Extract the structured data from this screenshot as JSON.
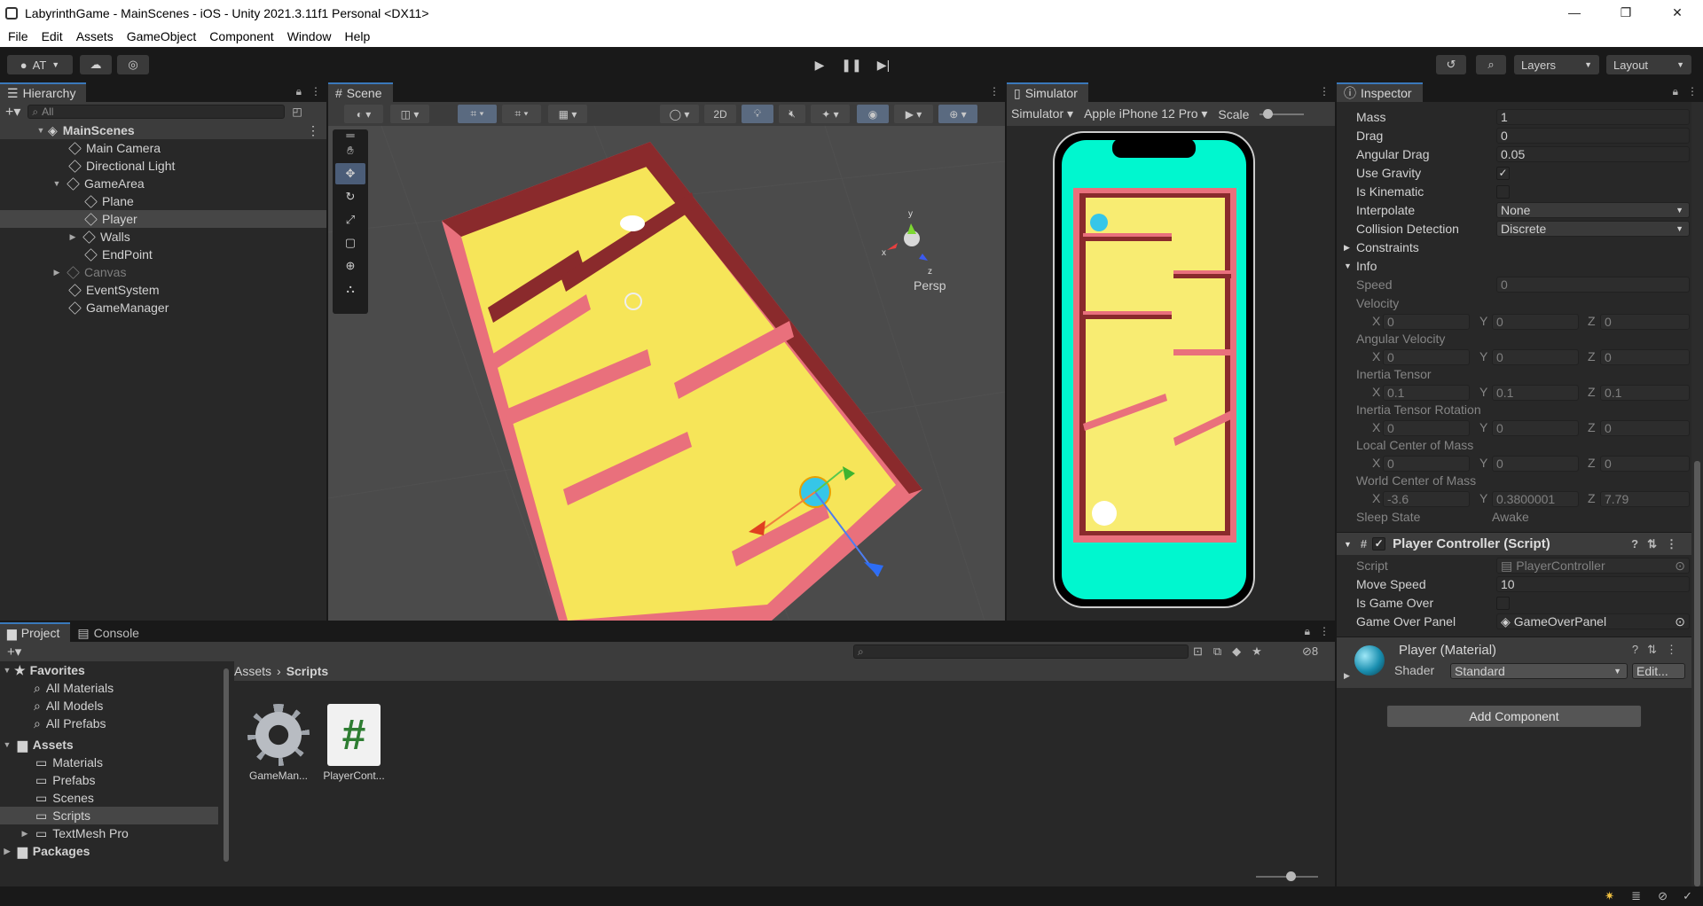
{
  "window": {
    "title": "LabyrinthGame - MainScenes - iOS - Unity 2021.3.11f1 Personal <DX11>",
    "controls": [
      "—",
      "❐",
      "✕"
    ]
  },
  "menu": [
    "File",
    "Edit",
    "Assets",
    "GameObject",
    "Component",
    "Window",
    "Help"
  ],
  "toolbar": {
    "account": "AT",
    "layers": "Layers",
    "layout": "Layout"
  },
  "hierarchy": {
    "tab": "Hierarchy",
    "search_placeholder": "All",
    "items": [
      {
        "label": "MainScenes",
        "indent": 0,
        "type": "scene",
        "expanded": true
      },
      {
        "label": "Main Camera",
        "indent": 1
      },
      {
        "label": "Directional Light",
        "indent": 1
      },
      {
        "label": "GameArea",
        "indent": 1,
        "expanded": true
      },
      {
        "label": "Plane",
        "indent": 2
      },
      {
        "label": "Player",
        "indent": 2,
        "selected": true
      },
      {
        "label": "Walls",
        "indent": 2,
        "collapsed": true
      },
      {
        "label": "EndPoint",
        "indent": 2
      },
      {
        "label": "Canvas",
        "indent": 1,
        "collapsed": true,
        "dim": true
      },
      {
        "label": "EventSystem",
        "indent": 1
      },
      {
        "label": "GameManager",
        "indent": 1
      }
    ]
  },
  "scene": {
    "tab": "Scene",
    "mode_2d": "2D",
    "persp_label": "Persp",
    "gizmo_axes": [
      "y",
      "x",
      "z"
    ]
  },
  "simulator": {
    "tab": "Simulator",
    "mode": "Simulator",
    "device": "Apple iPhone 12 Pro",
    "scale_label": "Scale"
  },
  "inspector": {
    "tab": "Inspector",
    "rigidbody": {
      "mass_label": "Mass",
      "mass": "1",
      "drag_label": "Drag",
      "drag": "0",
      "angular_drag_label": "Angular Drag",
      "angular_drag": "0.05",
      "use_gravity_label": "Use Gravity",
      "is_kinematic_label": "Is Kinematic",
      "interpolate_label": "Interpolate",
      "interpolate": "None",
      "collision_label": "Collision Detection",
      "collision": "Discrete",
      "constraints_label": "Constraints",
      "info_label": "Info",
      "speed_label": "Speed",
      "speed": "0",
      "velocity_label": "Velocity",
      "velocity": [
        "0",
        "0",
        "0"
      ],
      "angular_velocity_label": "Angular Velocity",
      "angular_velocity": [
        "0",
        "0",
        "0"
      ],
      "inertia_tensor_label": "Inertia Tensor",
      "inertia_tensor": [
        "0.1",
        "0.1",
        "0.1"
      ],
      "inertia_rotation_label": "Inertia Tensor Rotation",
      "inertia_rotation": [
        "0",
        "0",
        "0"
      ],
      "local_com_label": "Local Center of Mass",
      "local_com": [
        "0",
        "0",
        "0"
      ],
      "world_com_label": "World Center of Mass",
      "world_com": [
        "-3.6",
        "0.3800001",
        "7.79"
      ],
      "sleep_state_label": "Sleep State",
      "sleep_state": "Awake"
    },
    "axis_labels": [
      "X",
      "Y",
      "Z"
    ],
    "player_controller": {
      "header": "Player Controller (Script)",
      "script_label": "Script",
      "script": "PlayerController",
      "move_speed_label": "Move Speed",
      "move_speed": "10",
      "is_game_over_label": "Is Game Over",
      "game_over_panel_label": "Game Over Panel",
      "game_over_panel": "GameOverPanel"
    },
    "material": {
      "name": "Player (Material)",
      "shader_label": "Shader",
      "shader": "Standard",
      "edit": "Edit..."
    },
    "add_component": "Add Component"
  },
  "project": {
    "tabs": [
      "Project",
      "Console"
    ],
    "favorites_label": "Favorites",
    "favorites": [
      "All Materials",
      "All Models",
      "All Prefabs"
    ],
    "assets_label": "Assets",
    "assets_folders": [
      "Materials",
      "Prefabs",
      "Scenes",
      "Scripts",
      "TextMesh Pro"
    ],
    "packages_label": "Packages",
    "breadcrumb": [
      "Assets",
      "Scripts"
    ],
    "files": [
      {
        "name": "GameMan...",
        "icon": "gear-icon"
      },
      {
        "name": "PlayerCont...",
        "icon": "csharp-script-icon"
      }
    ],
    "hidden_count": "8"
  },
  "colors": {
    "accent": "#3a79bb",
    "wall": "#e9707c",
    "floor": "#ffff66",
    "sim_bg": "#00f7cf"
  }
}
